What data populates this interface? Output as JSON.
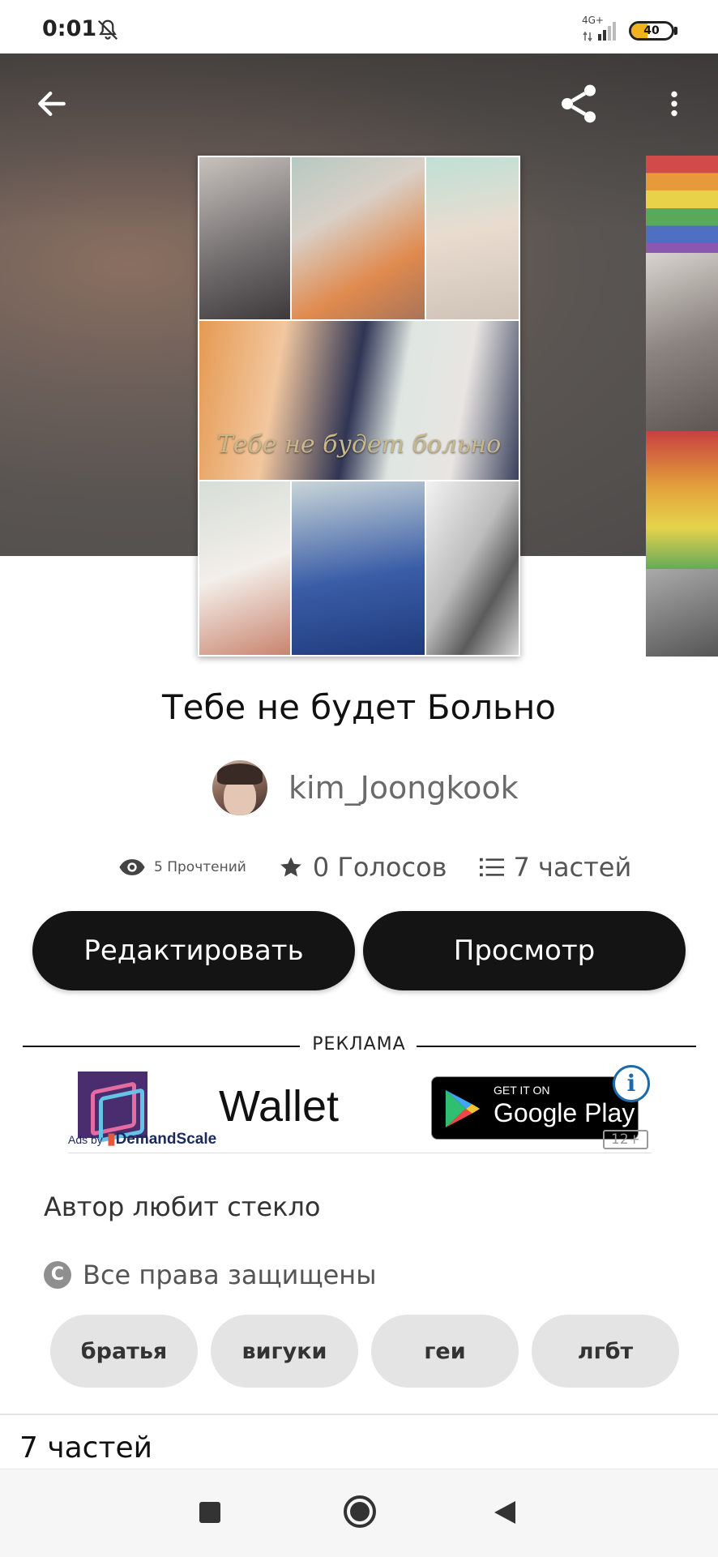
{
  "status": {
    "time": "0:01",
    "network": "4G+",
    "battery": "40"
  },
  "book": {
    "title": "Тебе не будет Больно",
    "cover_caption": "Тебе не будет больно",
    "author": "kim_Joongkook"
  },
  "stats": {
    "reads": "5 Прочтений",
    "votes": "0 Голосов",
    "parts": "7 частей"
  },
  "buttons": {
    "edit": "Редактировать",
    "view": "Просмотр"
  },
  "ad": {
    "label": "РЕКЛАМА",
    "brand": "Wallet",
    "store_small": "GET IT ON",
    "store_big": "Google Play",
    "age": "12+",
    "ads_by_prefix": "Ads by",
    "ads_by_brand": "DemandScale"
  },
  "description": "Автор любит стекло",
  "copyright": "Все права защищены",
  "tags": [
    "братья",
    "вигуки",
    "геи",
    "лгбт"
  ],
  "parts_heading": "7 частей"
}
